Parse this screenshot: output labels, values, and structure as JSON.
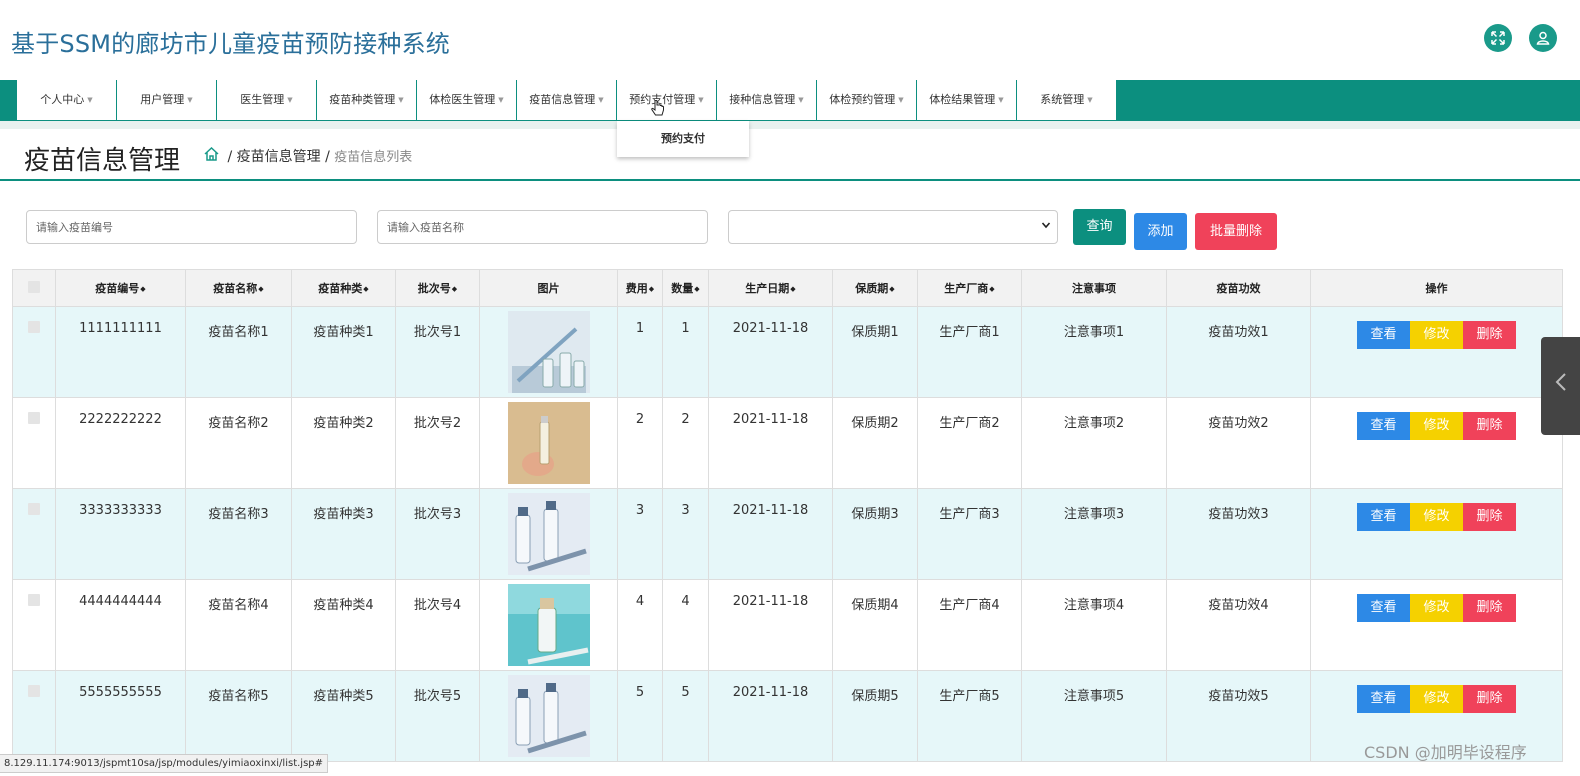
{
  "app": {
    "title": "基于SSM的廊坊市儿童疫苗预防接种系统"
  },
  "nav": {
    "items": [
      {
        "label": "个人中心"
      },
      {
        "label": "用户管理"
      },
      {
        "label": "医生管理"
      },
      {
        "label": "疫苗种类管理"
      },
      {
        "label": "体检医生管理"
      },
      {
        "label": "疫苗信息管理"
      },
      {
        "label": "预约支付管理"
      },
      {
        "label": "接种信息管理"
      },
      {
        "label": "体检预约管理"
      },
      {
        "label": "体检结果管理"
      },
      {
        "label": "系统管理"
      }
    ],
    "dropdown_item": "预约支付"
  },
  "page": {
    "title": "疫苗信息管理",
    "breadcrumb_sep": "/",
    "breadcrumb_section": "疫苗信息管理",
    "breadcrumb_current": "疫苗信息列表"
  },
  "search": {
    "code_placeholder": "请输入疫苗编号",
    "name_placeholder": "请输入疫苗名称",
    "query_label": "查询",
    "add_label": "添加",
    "batch_delete_label": "批量删除"
  },
  "table": {
    "headers": [
      "疫苗编号",
      "疫苗名称",
      "疫苗种类",
      "批次号",
      "图片",
      "费用",
      "数量",
      "生产日期",
      "保质期",
      "生产厂商",
      "注意事项",
      "疫苗功效",
      "操作"
    ],
    "actions": {
      "view": "查看",
      "edit": "修改",
      "delete": "删除"
    },
    "rows": [
      {
        "code": "1111111111",
        "name": "疫苗名称1",
        "type": "疫苗种类1",
        "batch": "批次号1",
        "fee": "1",
        "qty": "1",
        "date": "2021-11-18",
        "shelf": "保质期1",
        "maker": "生产厂商1",
        "notes": "注意事项1",
        "effect": "疫苗功效1"
      },
      {
        "code": "2222222222",
        "name": "疫苗名称2",
        "type": "疫苗种类2",
        "batch": "批次号2",
        "fee": "2",
        "qty": "2",
        "date": "2021-11-18",
        "shelf": "保质期2",
        "maker": "生产厂商2",
        "notes": "注意事项2",
        "effect": "疫苗功效2"
      },
      {
        "code": "3333333333",
        "name": "疫苗名称3",
        "type": "疫苗种类3",
        "batch": "批次号3",
        "fee": "3",
        "qty": "3",
        "date": "2021-11-18",
        "shelf": "保质期3",
        "maker": "生产厂商3",
        "notes": "注意事项3",
        "effect": "疫苗功效3"
      },
      {
        "code": "4444444444",
        "name": "疫苗名称4",
        "type": "疫苗种类4",
        "batch": "批次号4",
        "fee": "4",
        "qty": "4",
        "date": "2021-11-18",
        "shelf": "保质期4",
        "maker": "生产厂商4",
        "notes": "注意事项4",
        "effect": "疫苗功效4"
      },
      {
        "code": "5555555555",
        "name": "疫苗名称5",
        "type": "疫苗种类5",
        "batch": "批次号5",
        "fee": "5",
        "qty": "5",
        "date": "2021-11-18",
        "shelf": "保质期5",
        "maker": "生产厂商5",
        "notes": "注意事项5",
        "effect": "疫苗功效5"
      }
    ]
  },
  "status": {
    "url": "8.129.11.174:9013/jspmt10sa/jsp/modules/yimiaoxinxi/list.jsp#"
  },
  "watermark": "CSDN @加明毕设程序",
  "colors": {
    "brand": "#0c8f7f",
    "title": "#2a6f9a",
    "view": "#2d89e6",
    "edit": "#f5d100",
    "delete": "#f0425a",
    "add": "#2d89e6",
    "query": "#0c8f7f",
    "row_tint": "#e6f7f9"
  },
  "icons": [
    "fullscreen-icon",
    "user-icon",
    "home-icon",
    "sort-icon",
    "chevron-left-icon"
  ]
}
